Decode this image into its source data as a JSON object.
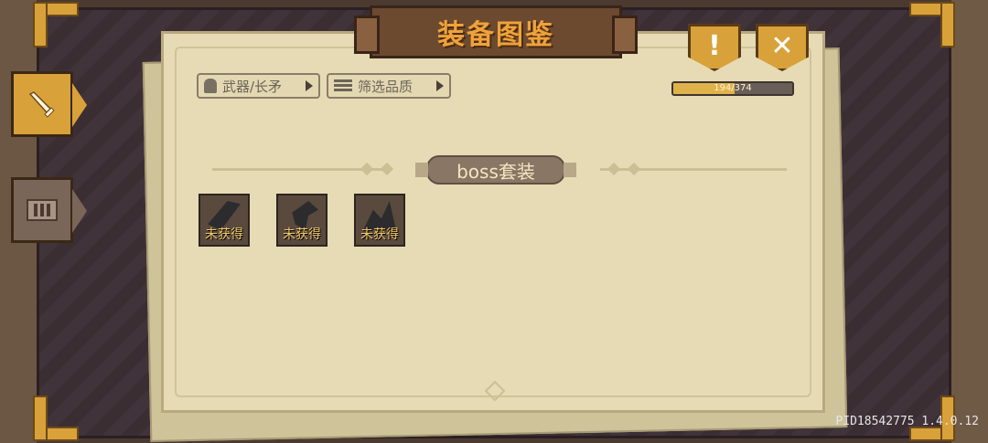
{
  "header": {
    "title": "装备图鉴"
  },
  "side_tabs": [
    {
      "name": "weapon",
      "icon": "sword-icon",
      "active": true
    },
    {
      "name": "armor",
      "icon": "armor-icon",
      "active": false
    }
  ],
  "buttons": {
    "info_symbol": "!",
    "close_symbol": "✕"
  },
  "filters": {
    "weapon_label": "武器/长矛",
    "quality_label": "筛选品质"
  },
  "progress": {
    "current": 194,
    "total": 374,
    "text": "194/374",
    "fraction": 0.5187
  },
  "section": {
    "title": "boss套装"
  },
  "items": [
    {
      "status": "未获得",
      "icon": "spear-icon"
    },
    {
      "status": "未获得",
      "icon": "dragon-head-icon"
    },
    {
      "status": "未获得",
      "icon": "crystal-shard-icon"
    }
  ],
  "footer": {
    "build": "PID18542775 1.4.0.12"
  },
  "colors": {
    "gold": "#d9a13a",
    "parchment": "#e6dbb5",
    "frame": "#3b2e33"
  }
}
